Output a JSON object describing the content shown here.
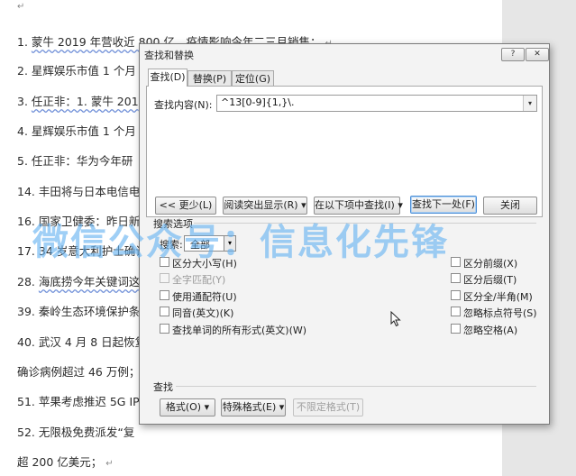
{
  "document": {
    "lines": [
      {
        "num": "1.",
        "text": "蒙牛 2019 年营收近 800 亿，疫情影响今年二三月销售；"
      },
      {
        "num": "2.",
        "text": "星辉娱乐市值 1 个月"
      },
      {
        "num": "3.",
        "text": "任正非：1. 蒙牛 201"
      },
      {
        "num": "4.",
        "text": "星辉娱乐市值 1 个月"
      },
      {
        "num": "5.",
        "text": "任正非：华为今年研"
      },
      {
        "num": "14.",
        "text": "丰田将与日本电信电"
      },
      {
        "num": "16.",
        "text": "国家卫健委：昨日新"
      },
      {
        "num": "17.",
        "text": "34 岁意大利护士确诊"
      },
      {
        "num": "28.",
        "text": "海底捞今年关键词这"
      },
      {
        "num": "39.",
        "text": "秦岭生态环境保护条"
      },
      {
        "num": "40.",
        "text": "武汉 4 月 8 日起恢复"
      },
      {
        "num": "",
        "text": "确诊病例超过 46 万例；"
      },
      {
        "num": "51.",
        "text": "苹果考虑推迟 5G IP"
      },
      {
        "num": "52.",
        "text": "无限极免费派发“复"
      },
      {
        "num": "",
        "text": "超 200 亿美元；"
      }
    ],
    "paragraph_mark": "↵"
  },
  "watermark": "微信公众号：信息化先锋",
  "dialog": {
    "title": "查找和替换",
    "help_label": "?",
    "close_label": "✕",
    "tabs": [
      "查找(D)",
      "替换(P)",
      "定位(G)"
    ],
    "find_label": "查找内容(N):",
    "find_value": "^13[0-9]{1,}\\.",
    "combo_arrow": "▾",
    "buttons": {
      "less": "<< 更少(L)",
      "reading_highlight": "阅读突出显示(R) ▾",
      "find_in": "在以下项中查找(I) ▾",
      "find_next": "查找下一处(F)",
      "close": "关闭"
    },
    "search_options_label": "搜索选项",
    "search_label": "搜索:",
    "search_value": "全部",
    "left_options": [
      {
        "label": "区分大小写(H)",
        "checked": false,
        "disabled": false
      },
      {
        "label": "全字匹配(Y)",
        "checked": false,
        "disabled": true
      },
      {
        "label": "使用通配符(U)",
        "checked": false,
        "disabled": false
      },
      {
        "label": "同音(英文)(K)",
        "checked": false,
        "disabled": false
      },
      {
        "label": "查找单词的所有形式(英文)(W)",
        "checked": false,
        "disabled": false
      }
    ],
    "right_options": [
      {
        "label": "区分前缀(X)",
        "checked": false,
        "disabled": false
      },
      {
        "label": "区分后缀(T)",
        "checked": false,
        "disabled": false
      },
      {
        "label": "区分全/半角(M)",
        "checked": false,
        "disabled": false
      },
      {
        "label": "忽略标点符号(S)",
        "checked": false,
        "disabled": false
      },
      {
        "label": "忽略空格(A)",
        "checked": false,
        "disabled": false
      }
    ],
    "find_section_label": "查找",
    "format_buttons": {
      "format": "格式(O) ▾",
      "special": "特殊格式(E) ▾",
      "no_format": "不限定格式(T)"
    }
  }
}
